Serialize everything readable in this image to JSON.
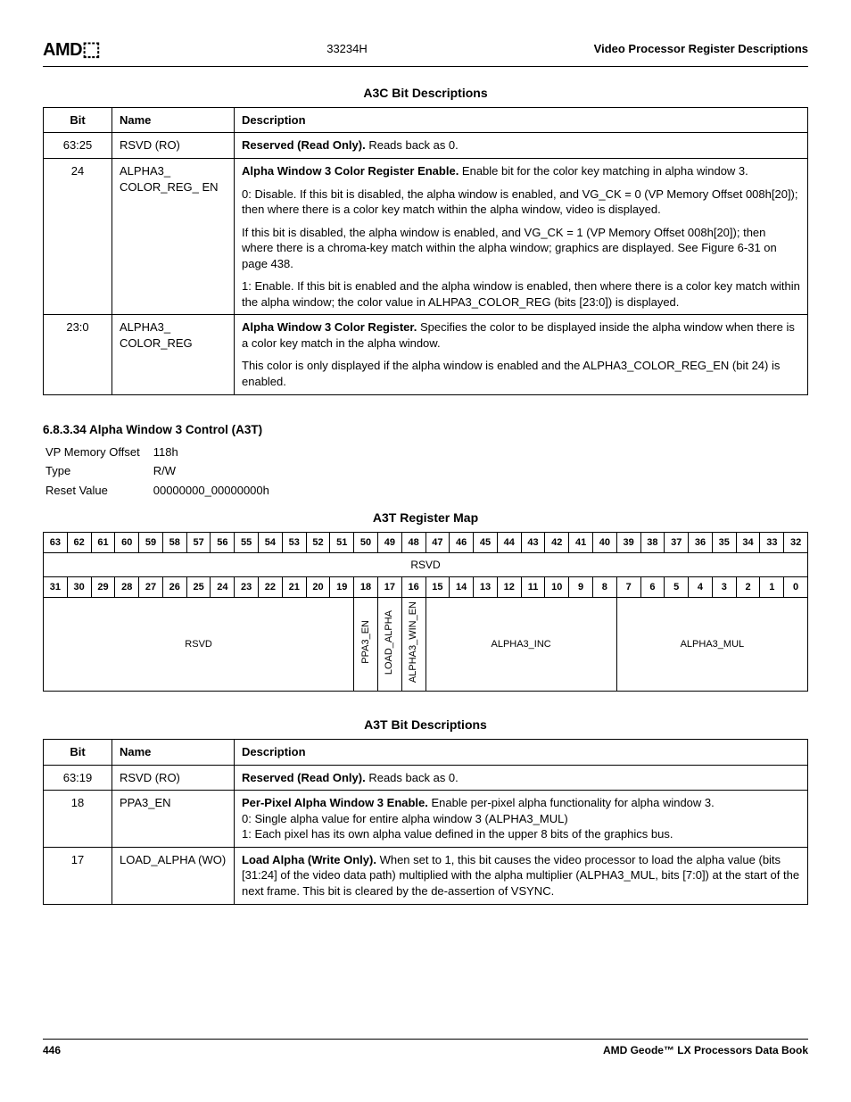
{
  "header": {
    "logo": "AMD",
    "doc_code": "33234H",
    "section": "Video Processor Register Descriptions"
  },
  "a3c": {
    "title": "A3C Bit Descriptions",
    "headers": {
      "bit": "Bit",
      "name": "Name",
      "desc": "Description"
    },
    "rows": [
      {
        "bit": "63:25",
        "name": "RSVD (RO)",
        "desc_bold": "Reserved (Read Only).",
        "desc_rest": " Reads back as 0."
      },
      {
        "bit": "24",
        "name": "ALPHA3_ COLOR_REG_ EN",
        "p1_bold": "Alpha Window 3 Color Register Enable.",
        "p1_rest": " Enable bit for the color key matching in alpha window 3.",
        "p2": "0: Disable. If this bit is disabled, the alpha window is enabled, and VG_CK = 0 (VP Memory Offset 008h[20]); then where there is a color key match within the alpha window, video is displayed.",
        "p3": "If this bit is disabled, the alpha window is enabled, and VG_CK = 1 (VP Memory Offset 008h[20]); then where there is a chroma-key match within the alpha window; graphics are displayed. See Figure 6-31 on page 438.",
        "p4": "1: Enable. If this bit is enabled and the alpha window is enabled, then where there is a color key match within the alpha window; the color value in ALHPA3_COLOR_REG (bits [23:0]) is displayed."
      },
      {
        "bit": "23:0",
        "name": "ALPHA3_ COLOR_REG",
        "p1_bold": "Alpha Window 3 Color Register.",
        "p1_rest": " Specifies the color to be displayed inside the alpha window when there is a color key match in the alpha window.",
        "p2": "This color is only displayed if the alpha window is enabled and the ALPHA3_COLOR_REG_EN (bit 24) is enabled."
      }
    ]
  },
  "a3t_section": {
    "heading": "6.8.3.34   Alpha Window 3 Control (A3T)",
    "meta": {
      "offset_label": "VP Memory Offset",
      "offset_value": "118h",
      "type_label": "Type",
      "type_value": "R/W",
      "reset_label": "Reset Value",
      "reset_value": "00000000_00000000h"
    },
    "regmap_title": "A3T Register Map",
    "regmap": {
      "row1_field": "RSVD",
      "row2_rsvd": "RSVD",
      "row2_ppa3": "PPA3_EN",
      "row2_load": "LOAD_ALPHA",
      "row2_win": "ALPHA3_WIN_EN",
      "row2_inc": "ALPHA3_INC",
      "row2_mul": "ALPHA3_MUL"
    }
  },
  "a3t": {
    "title": "A3T Bit Descriptions",
    "headers": {
      "bit": "Bit",
      "name": "Name",
      "desc": "Description"
    },
    "rows": [
      {
        "bit": "63:19",
        "name": "RSVD (RO)",
        "desc_bold": "Reserved (Read Only).",
        "desc_rest": " Reads back as 0."
      },
      {
        "bit": "18",
        "name": "PPA3_EN",
        "desc_bold": "Per-Pixel Alpha Window 3 Enable.",
        "desc_rest": " Enable per-pixel alpha functionality for alpha window 3.",
        "line0": "0: Single alpha value for entire alpha window 3 (ALPHA3_MUL)",
        "line1": "1: Each pixel has its own alpha value defined in the upper 8 bits of the graphics bus."
      },
      {
        "bit": "17",
        "name": "LOAD_ALPHA (WO)",
        "desc_bold": "Load Alpha (Write Only).",
        "desc_rest": " When set to 1, this bit causes the video processor to load the alpha value (bits [31:24] of the video data path) multiplied with the alpha multiplier (ALPHA3_MUL, bits [7:0]) at the start of the next frame. This bit is cleared by the de-assertion of VSYNC."
      }
    ]
  },
  "footer": {
    "page": "446",
    "title": "AMD Geode™ LX Processors Data Book"
  }
}
